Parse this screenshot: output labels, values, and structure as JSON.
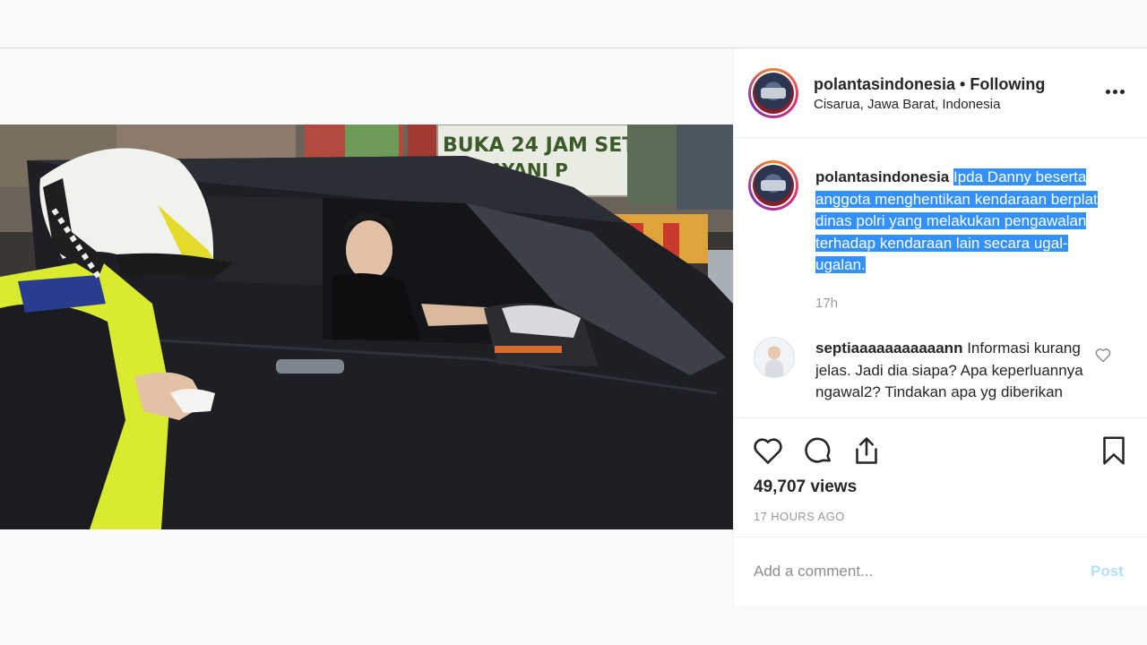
{
  "post": {
    "username": "polantasindonesia",
    "separator": "•",
    "follow_status": "Following",
    "location": "Cisarua, Jawa Barat, Indonesia",
    "caption_username": "polantasindonesia",
    "caption_text": "Ipda Danny beserta anggota menghentikan kendaraan berplat dinas polri yang melakukan pengawalan terhadap kendaraan lain secara ugal-ugalan.",
    "caption_time": "17h",
    "comments": [
      {
        "username": "septiaaaaaaaaaaann",
        "text": "Informasi kurang jelas. Jadi dia siapa? Apa keperluannya ngawal2? Tindakan apa yg diberikan"
      }
    ],
    "views": "49,707 views",
    "posted_ago": "17 HOURS AGO",
    "comment_placeholder": "Add a comment...",
    "post_button": "Post"
  },
  "video": {
    "sign_line1": "BUKA 24 JAM SETIAP",
    "sign_line2": "MELAYANI P"
  },
  "icons": {
    "more": "more-options-icon",
    "like": "heart-icon",
    "comment": "comment-bubble-icon",
    "share": "share-icon",
    "save": "bookmark-icon",
    "comment_like": "small-heart-icon"
  },
  "colors": {
    "highlight": "#3390ff",
    "post_button_disabled": "#b2dffc",
    "muted_text": "#999999"
  }
}
